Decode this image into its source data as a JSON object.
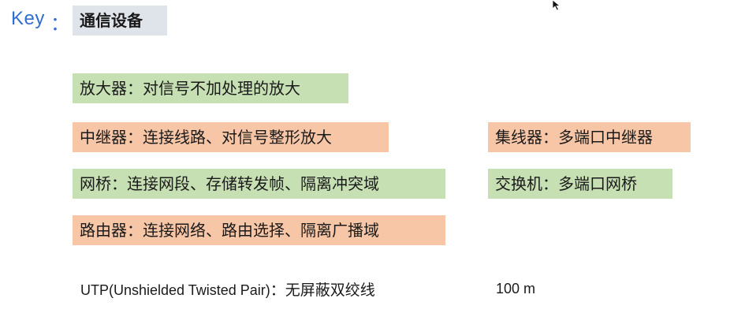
{
  "header": {
    "key_label": "Key",
    "key_colon": "：",
    "topic": "通信设备"
  },
  "devices": {
    "amplifier": "放大器：对信号不加处理的放大",
    "repeater": "中继器：连接线路、对信号整形放大",
    "hub": "集线器：多端口中继器",
    "bridge": "网桥：连接网段、存储转发帧、隔离冲突域",
    "switch": "交换机：多端口网桥",
    "router": "路由器：连接网络、路由选择、隔离广播域"
  },
  "utp": {
    "term": "UTP(Unshielded Twisted Pair)",
    "definition": "：无屏蔽双绞线",
    "distance": "100 m"
  },
  "colors": {
    "key_blue": "#2f6fd1",
    "green_box": "#c6dfb3",
    "orange_box": "#f7c6a6",
    "topic_box": "#dfe3ea"
  },
  "icons": {
    "cursor": "mouse-pointer-icon"
  }
}
